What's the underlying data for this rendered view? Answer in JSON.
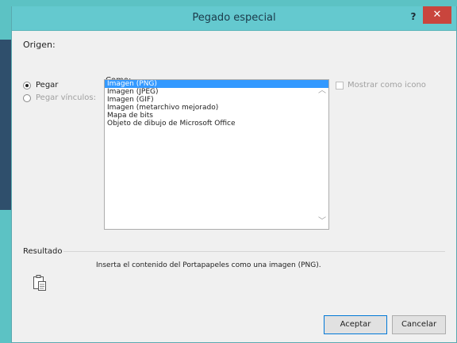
{
  "dialog": {
    "title": "Pegado especial",
    "help": "?",
    "close": "✕"
  },
  "origin": {
    "label": "Origen:"
  },
  "options": {
    "paste": "Pegar",
    "paste_links": "Pegar vínculos:"
  },
  "como": {
    "label": "Como:",
    "items": [
      "Imagen (PNG)",
      "Imagen (JPEG)",
      "Imagen (GIF)",
      "Imagen (metarchivo mejorado)",
      "Mapa de bits",
      "Objeto de dibujo de Microsoft Office"
    ],
    "selected_index": 0
  },
  "show_icon": {
    "label": "Mostrar como icono",
    "checked": false
  },
  "result": {
    "label": "Resultado",
    "description": "Inserta el contenido del Portapapeles como una imagen (PNG)."
  },
  "buttons": {
    "accept": "Aceptar",
    "cancel": "Cancelar"
  }
}
